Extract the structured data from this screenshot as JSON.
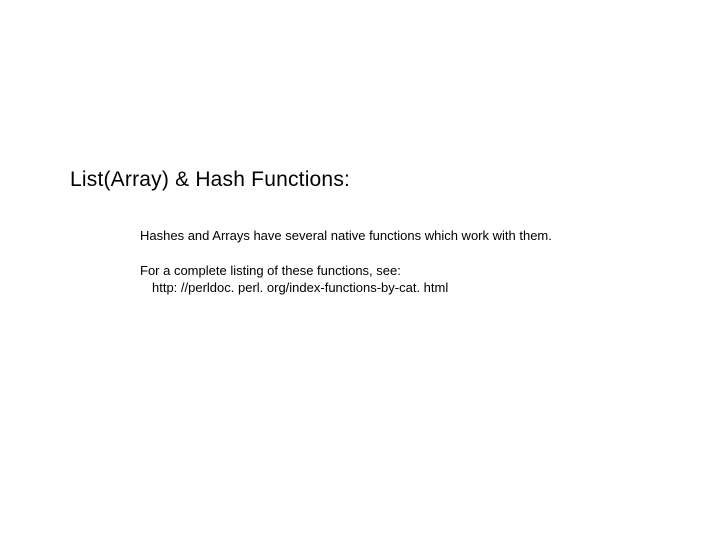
{
  "title": "List(Array) & Hash Functions:",
  "body": {
    "para1": "Hashes and Arrays have several native functions which work with them.",
    "para2_line1": "For a complete listing of these functions, see:",
    "para2_line2": "http: //perldoc. perl. org/index-functions-by-cat. html"
  }
}
